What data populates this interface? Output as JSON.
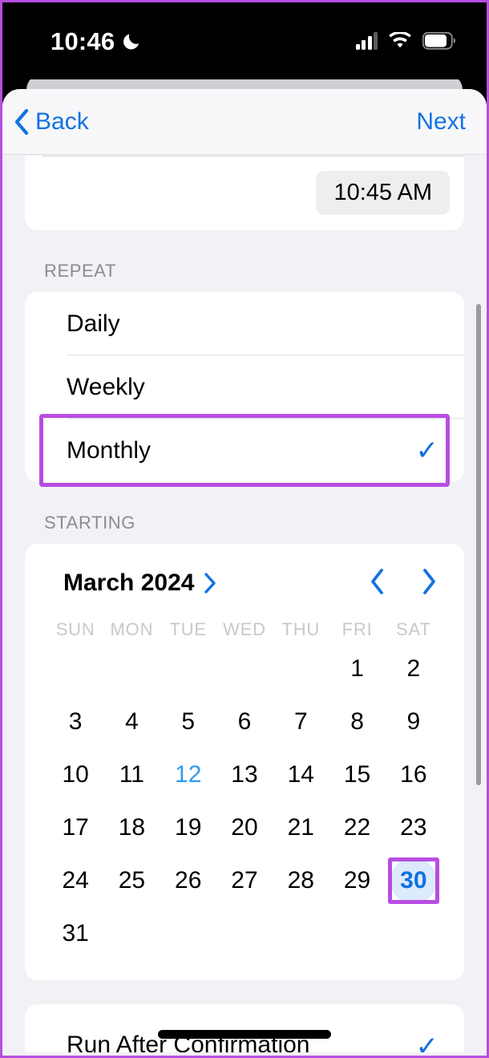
{
  "status_bar": {
    "time": "10:46",
    "dnd_icon": "moon-icon",
    "cellular_icon": "cellular-bars-icon",
    "wifi_icon": "wifi-icon",
    "battery_icon": "battery-icon"
  },
  "nav": {
    "back_label": "Back",
    "next_label": "Next",
    "back_icon": "chevron-left-icon"
  },
  "time_row": {
    "value": "10:45 AM"
  },
  "repeat": {
    "section_label": "REPEAT",
    "options": [
      {
        "label": "Daily",
        "selected": false
      },
      {
        "label": "Weekly",
        "selected": false
      },
      {
        "label": "Monthly",
        "selected": true
      }
    ],
    "check_glyph": "✓"
  },
  "starting": {
    "section_label": "STARTING",
    "calendar": {
      "month_label": "March 2024",
      "month_chevron": "›",
      "prev_icon": "chevron-left-icon",
      "next_icon": "chevron-right-icon",
      "weekdays": [
        "SUN",
        "MON",
        "TUE",
        "WED",
        "THU",
        "FRI",
        "SAT"
      ],
      "weeks": [
        [
          "",
          "",
          "",
          "",
          "",
          "1",
          "2"
        ],
        [
          "3",
          "4",
          "5",
          "6",
          "7",
          "8",
          "9"
        ],
        [
          "10",
          "11",
          "12",
          "13",
          "14",
          "15",
          "16"
        ],
        [
          "17",
          "18",
          "19",
          "20",
          "21",
          "22",
          "23"
        ],
        [
          "24",
          "25",
          "26",
          "27",
          "28",
          "29",
          "30"
        ],
        [
          "31",
          "",
          "",
          "",
          "",
          "",
          ""
        ]
      ],
      "today": "12",
      "selected_day": "30"
    }
  },
  "bottom_row": {
    "label": "Run After Confirmation",
    "check_glyph": "✓"
  },
  "annotations": {
    "highlight_color": "#b84de2",
    "targets": [
      "monthly-option",
      "day-30"
    ]
  },
  "colors": {
    "accent_blue": "#1272e4",
    "selected_day_bg": "#dbeafd",
    "today_blue": "#2f9bf0",
    "sheet_bg": "#f2f1f6"
  }
}
